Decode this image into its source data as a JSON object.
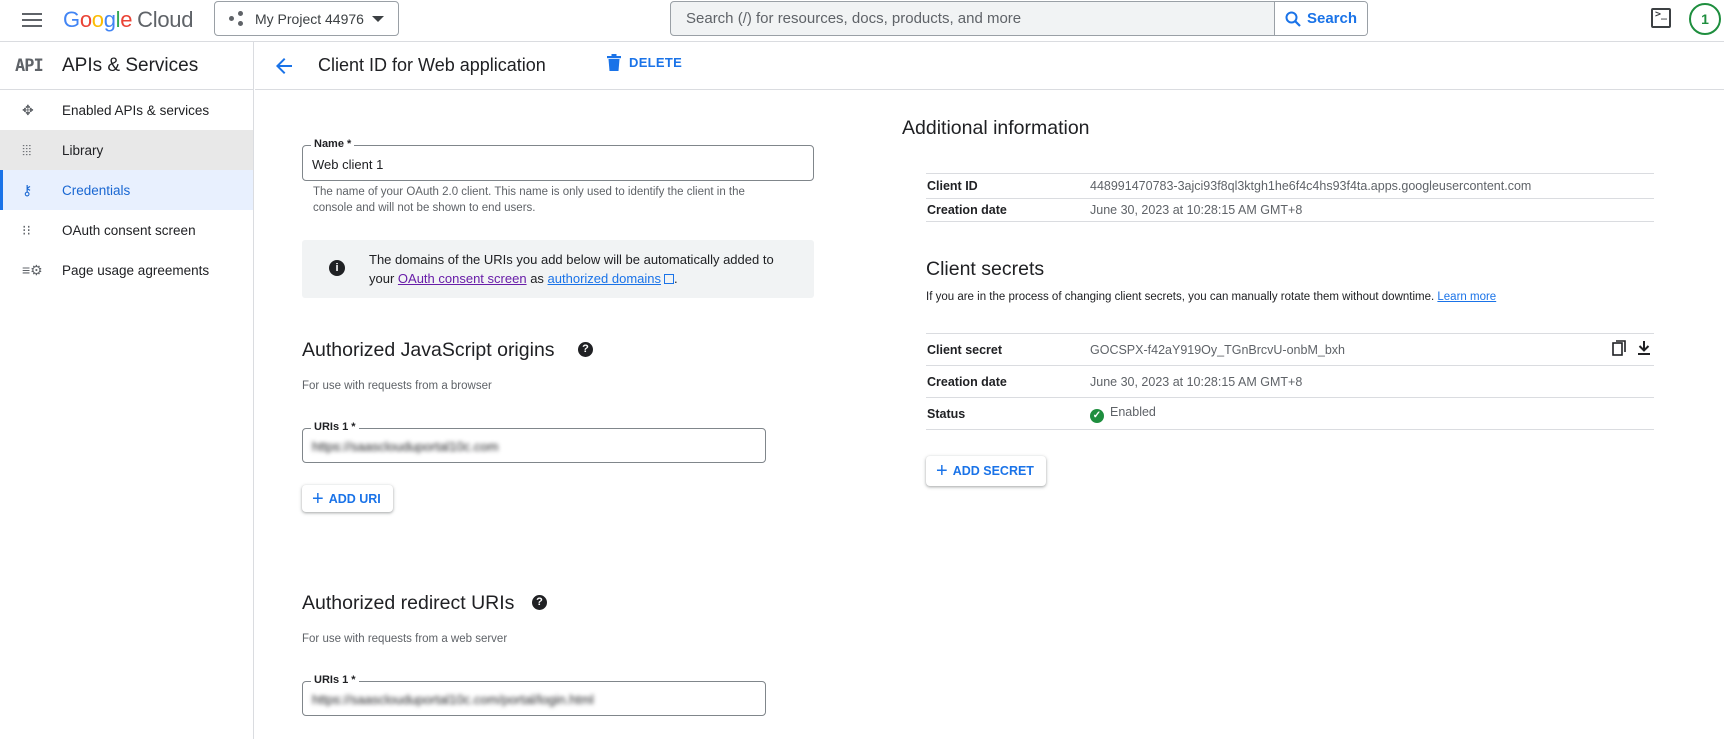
{
  "topbar": {
    "logo_text": "Google",
    "logo_suffix": "Cloud",
    "project_name": "My Project 44976",
    "search_placeholder": "Search (/) for resources, docs, products, and more",
    "search_button": "Search",
    "avatar_letter": "1"
  },
  "sidebar": {
    "title": "APIs & Services",
    "items": [
      {
        "label": "Enabled APIs & services",
        "icon": "hub-icon"
      },
      {
        "label": "Library",
        "icon": "library-icon"
      },
      {
        "label": "Credentials",
        "icon": "key-icon"
      },
      {
        "label": "OAuth consent screen",
        "icon": "consent-icon"
      },
      {
        "label": "Page usage agreements",
        "icon": "settings-list-icon"
      }
    ]
  },
  "header": {
    "title": "Client ID for Web application",
    "delete_label": "DELETE"
  },
  "form": {
    "name_label": "Name *",
    "name_value": "Web client 1",
    "name_hint_line1": "The name of your OAuth 2.0 client. This name is only used to identify the client in the",
    "name_hint_line2": "console and will not be shown to end users.",
    "info_text_1": "The domains of the URIs you add below will be automatically added to",
    "info_text_2": "your",
    "info_link_1": "OAuth consent screen",
    "info_text_3": "as",
    "info_link_2": "authorized domains",
    "info_text_4": ".",
    "js_origins_title": "Authorized JavaScript origins",
    "js_origins_hint": "For use with requests from a browser",
    "js_uri_label": "URIs 1 *",
    "js_uri_value": "https://saasclouduportal10c.com",
    "add_uri_label": "ADD URI",
    "redirect_title": "Authorized redirect URIs",
    "redirect_hint": "For use with requests from a web server",
    "redirect_uri_label": "URIs 1 *",
    "redirect_uri_value": "https://saasclouduportal10c.com/portal/login.html"
  },
  "info": {
    "title": "Additional information",
    "client_id_label": "Client ID",
    "client_id_value": "448991470783-3ajci93f8ql3ktgh1he6f4c4hs93f4ta.apps.googleusercontent.com",
    "creation_label": "Creation date",
    "creation_value": "June 30, 2023 at 10:28:15 AM GMT+8"
  },
  "secrets": {
    "title": "Client secrets",
    "desc": "If you are in the process of changing client secrets, you can manually rotate them without downtime.",
    "learn_more": "Learn more",
    "secret_label": "Client secret",
    "secret_value": "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",
    "creation_label": "Creation date",
    "creation_value": "June 30, 2023 at 10:28:15 AM GMT+8",
    "status_label": "Status",
    "status_value": "Enabled",
    "add_secret_label": "ADD SECRET"
  },
  "colors": {
    "accent": "#1a73e8",
    "active_bg": "#e8f0fe",
    "success": "#1e8e3e"
  }
}
